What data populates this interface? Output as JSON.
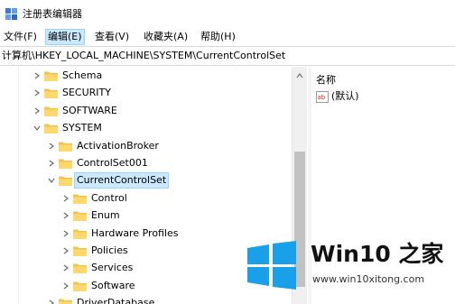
{
  "window": {
    "title": "注册表编辑器"
  },
  "menu": [
    {
      "label": "文件(F)",
      "active": false
    },
    {
      "label": "编辑(E)",
      "active": true
    },
    {
      "label": "查看(V)",
      "active": false
    },
    {
      "label": "收藏夹(A)",
      "active": false
    },
    {
      "label": "帮助(H)",
      "active": false
    }
  ],
  "address": {
    "path": "计算机\\HKEY_LOCAL_MACHINE\\SYSTEM\\CurrentControlSet"
  },
  "tree": {
    "items": [
      {
        "label": "Schema",
        "level": 1,
        "expanded": false
      },
      {
        "label": "SECURITY",
        "level": 1,
        "expanded": false
      },
      {
        "label": "SOFTWARE",
        "level": 1,
        "expanded": false
      },
      {
        "label": "SYSTEM",
        "level": 1,
        "expanded": true
      },
      {
        "label": "ActivationBroker",
        "level": 2,
        "expanded": false
      },
      {
        "label": "ControlSet001",
        "level": 2,
        "expanded": false
      },
      {
        "label": "CurrentControlSet",
        "level": 2,
        "expanded": true,
        "selected": true
      },
      {
        "label": "Control",
        "level": 3,
        "expanded": false
      },
      {
        "label": "Enum",
        "level": 3,
        "expanded": false
      },
      {
        "label": "Hardware Profiles",
        "level": 3,
        "expanded": false
      },
      {
        "label": "Policies",
        "level": 3,
        "expanded": false
      },
      {
        "label": "Services",
        "level": 3,
        "expanded": false
      },
      {
        "label": "Software",
        "level": 3,
        "expanded": false
      },
      {
        "label": "DriverDatabase",
        "level": 2,
        "expanded": false
      }
    ]
  },
  "values_pane": {
    "column_name": "名称",
    "values": [
      {
        "icon": "string-value-icon",
        "name": "(默认)"
      }
    ]
  },
  "watermark": {
    "brand": "Win10 之家",
    "url": "www.win10xitong.com"
  },
  "colors": {
    "selection": "#cce8ff",
    "selection_border": "#99d1ff",
    "folder": "#f5c34c",
    "win_logo": "#1aa0e8"
  }
}
